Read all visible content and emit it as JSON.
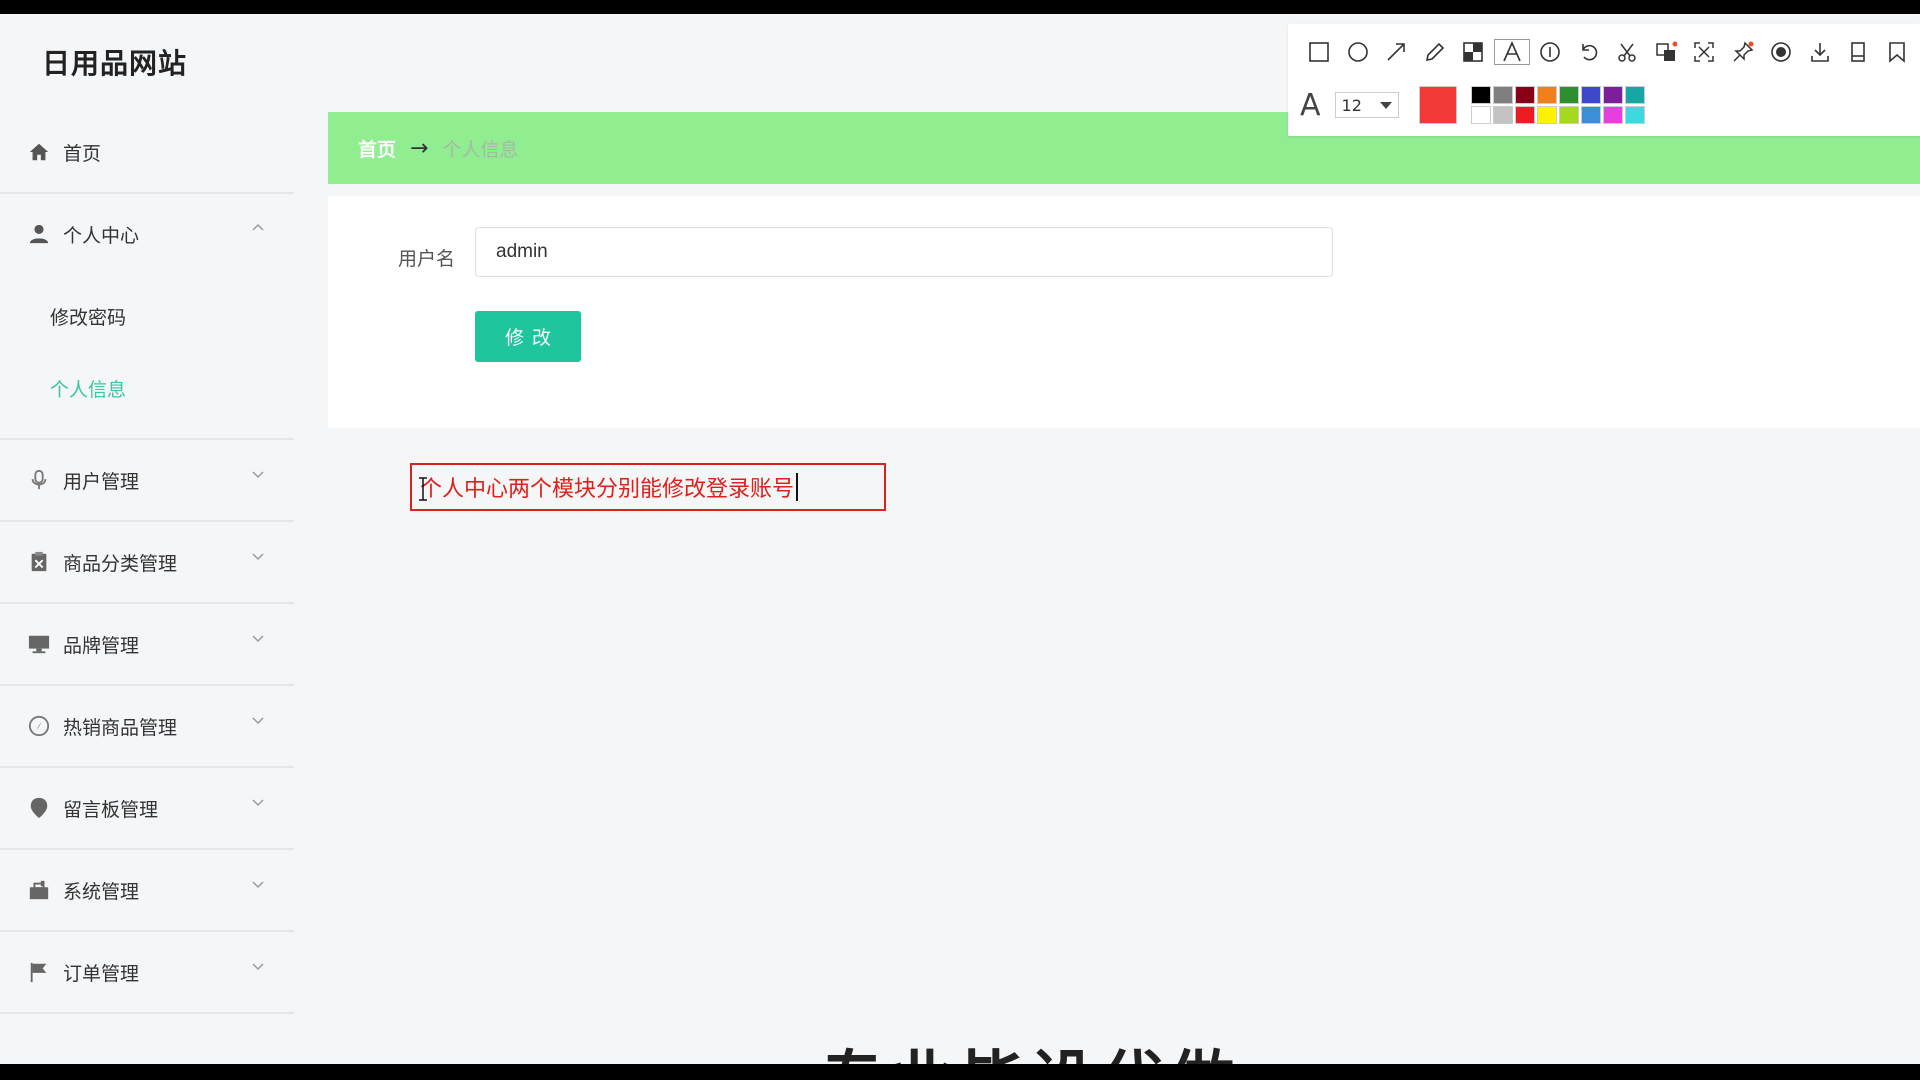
{
  "site_title": "日用品网站",
  "sidebar": {
    "items": [
      {
        "label": "首页",
        "icon": "home-icon"
      },
      {
        "label": "个人中心",
        "icon": "user-icon",
        "expanded": true,
        "children": [
          {
            "label": "修改密码"
          },
          {
            "label": "个人信息",
            "active": true
          }
        ]
      },
      {
        "label": "用户管理",
        "icon": "microphone-icon"
      },
      {
        "label": "商品分类管理",
        "icon": "clipboard-icon"
      },
      {
        "label": "品牌管理",
        "icon": "monitor-icon"
      },
      {
        "label": "热销商品管理",
        "icon": "compass-icon"
      },
      {
        "label": "留言板管理",
        "icon": "location-icon"
      },
      {
        "label": "系统管理",
        "icon": "toolbox-icon"
      },
      {
        "label": "订单管理",
        "icon": "flag-icon"
      }
    ]
  },
  "breadcrumb": {
    "home": "首页",
    "separator": "→",
    "current": "个人信息"
  },
  "form": {
    "username_label": "用户名",
    "username_value": "admin",
    "submit_label": "修改"
  },
  "annotation": {
    "text": "个人中心两个模块分别能修改登录账号"
  },
  "bottom_overlay": {
    "text": "专业毕设代做"
  },
  "toolbar": {
    "tools": [
      "rectangle-icon",
      "ellipse-icon",
      "arrow-icon",
      "pencil-icon",
      "mosaic-icon",
      "text-icon",
      "number-icon",
      "undo-icon",
      "cut-icon",
      "translate-icon",
      "long-screenshot-icon",
      "pin-icon",
      "record-icon",
      "download-icon",
      "copy-icon",
      "bookmark-icon"
    ],
    "active_tool": "text-icon",
    "font_size": "12",
    "current_color": "#f23a3a",
    "palette": [
      "#000000",
      "#7f7f7f",
      "#880015",
      "#f07f1d",
      "#2f8f2f",
      "#3f48cc",
      "#7c1f9a",
      "#18a5a5",
      "#ffffff",
      "#c3c3c3",
      "#ed1c24",
      "#fff200",
      "#a6d81e",
      "#3b8fd8",
      "#e83ee0",
      "#3ed9e0"
    ]
  },
  "colors": {
    "accent": "#1ec59d",
    "active_text": "#3cc6a3",
    "breadcrumb_bg": "#90ee90",
    "annotation": "#e0201a"
  }
}
